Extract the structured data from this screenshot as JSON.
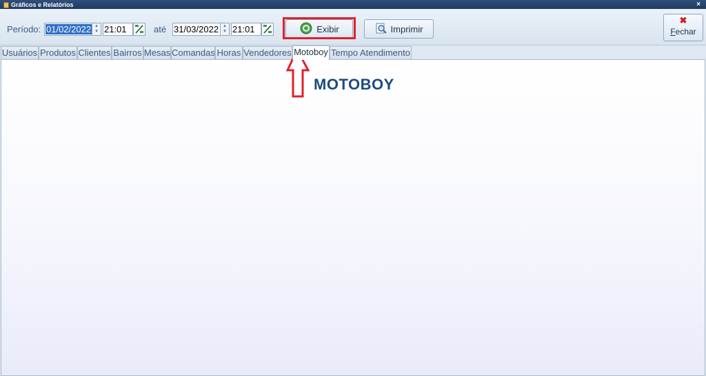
{
  "window": {
    "title": "Gráficos e Relatórios",
    "close_glyph": "×"
  },
  "filter": {
    "period_label": "Período:",
    "start_date": "01/02/2022",
    "start_time": "21:01",
    "until_label": "até",
    "end_date": "31/03/2022",
    "end_time": "21:01"
  },
  "toolbar": {
    "show_label": "Exibir",
    "print_label": "Imprimir",
    "close_label": "Fechar"
  },
  "tabs": [
    {
      "label": "Usuários"
    },
    {
      "label": "Produtos"
    },
    {
      "label": "Clientes"
    },
    {
      "label": "Bairros"
    },
    {
      "label": "Mesas"
    },
    {
      "label": "Comandas"
    },
    {
      "label": "Horas"
    },
    {
      "label": "Vendedores"
    },
    {
      "label": "Motoboy",
      "active": true
    },
    {
      "label": "Tempo Atendimento"
    }
  ],
  "panel": {
    "title": "MOTOBOY"
  },
  "icons": {
    "app": "app-icon",
    "close": "close-icon",
    "calendar": "calendar-icon",
    "show": "refresh-circle-icon",
    "print": "magnifier-print-icon",
    "fechar": "red-x-icon"
  },
  "colors": {
    "annotation": "#e0202a",
    "title": "#1d4a7e",
    "titlebar": "#2f4f7a"
  }
}
